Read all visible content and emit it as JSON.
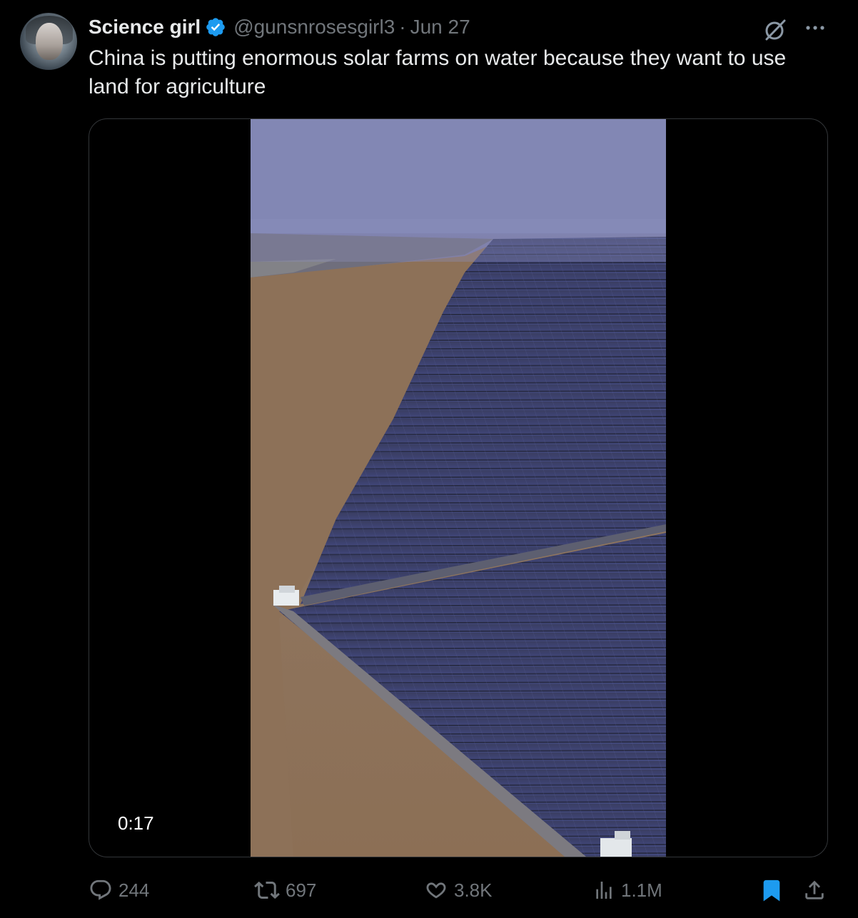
{
  "author": {
    "display_name": "Science girl",
    "handle": "@gunsnrosesgirl3",
    "separator": "·",
    "date": "Jun 27",
    "verified": true,
    "verified_color": "#1d9bf0"
  },
  "tweet": {
    "text": "China is putting enormous solar farms on water because they want to use land  for agriculture"
  },
  "media": {
    "type": "video",
    "duration": "0:17"
  },
  "actions": {
    "replies": "244",
    "reposts": "697",
    "likes": "3.8K",
    "views": "1.1M",
    "bookmarked": true,
    "bookmark_color": "#1d9bf0"
  },
  "colors": {
    "background": "#000000",
    "text_primary": "#e7e9ea",
    "text_secondary": "#71767b",
    "accent": "#1d9bf0"
  },
  "icons": [
    "avatar",
    "verified-badge-icon",
    "grok-icon",
    "more-icon",
    "reply-icon",
    "repost-icon",
    "like-icon",
    "views-icon",
    "bookmark-icon",
    "share-icon"
  ]
}
